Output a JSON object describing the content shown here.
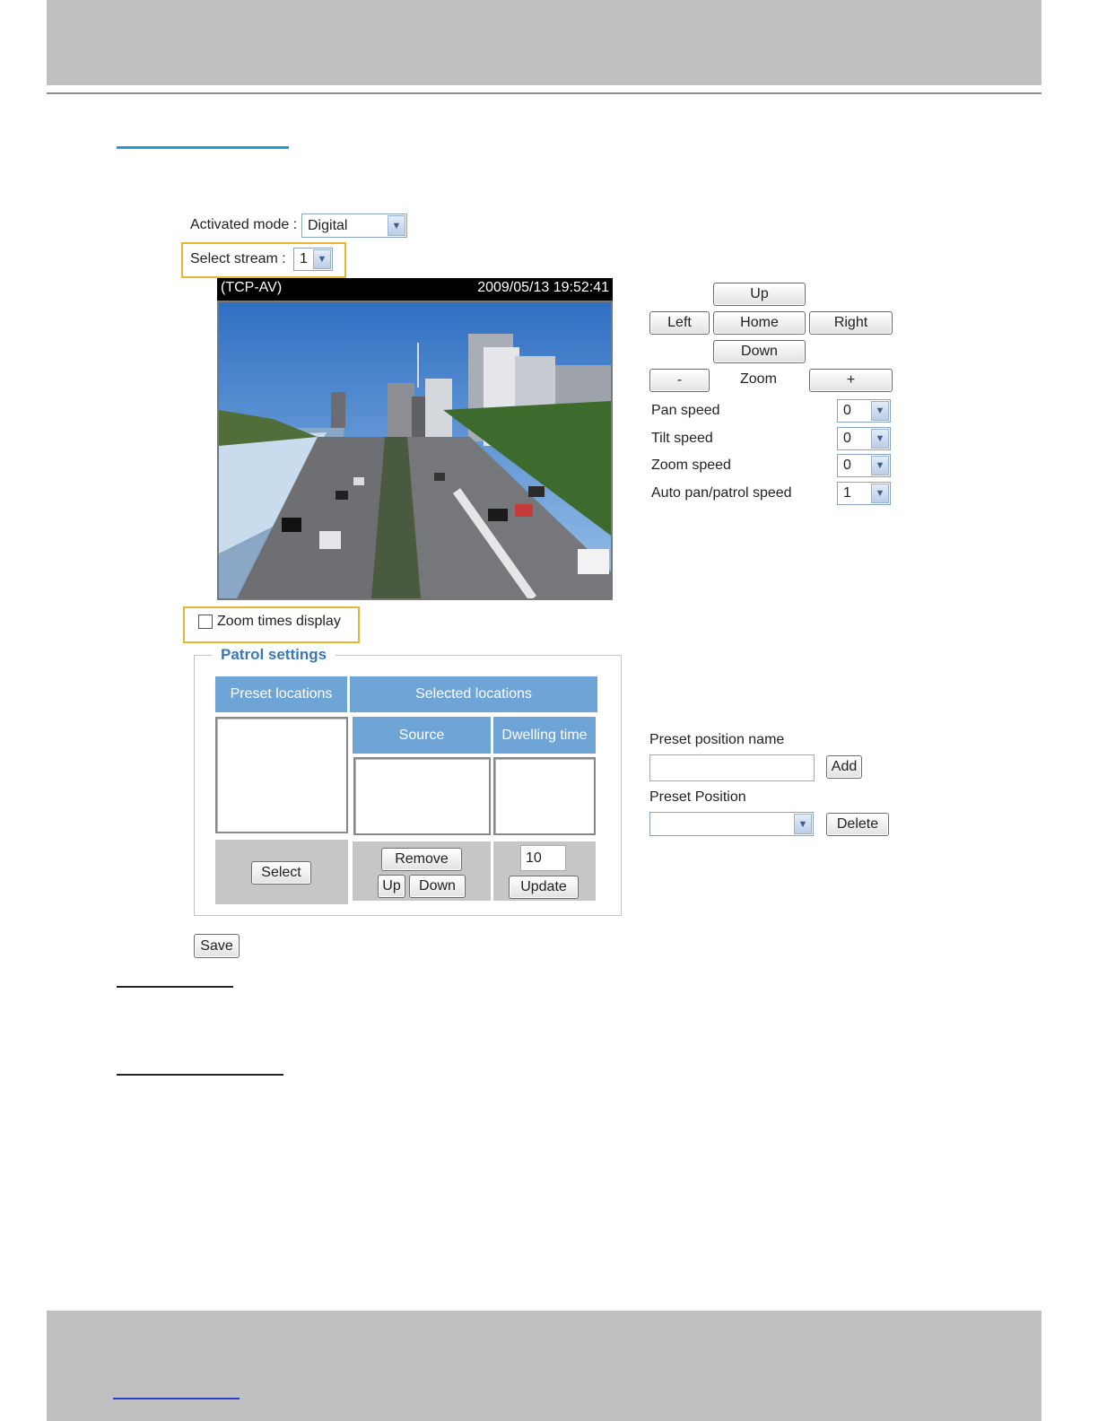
{
  "controls": {
    "activated_mode_label": "Activated mode :",
    "activated_mode_value": "Digital",
    "select_stream_label": "Select stream :",
    "select_stream_value": "1"
  },
  "video": {
    "protocol": "(TCP-AV)",
    "timestamp": "2009/05/13 19:52:41"
  },
  "ptz": {
    "up": "Up",
    "left": "Left",
    "home": "Home",
    "right": "Right",
    "down": "Down",
    "zoom_out": "-",
    "zoom_label": "Zoom",
    "zoom_in": "+",
    "speeds": [
      {
        "label": "Pan speed",
        "value": "0"
      },
      {
        "label": "Tilt speed",
        "value": "0"
      },
      {
        "label": "Zoom speed",
        "value": "0"
      },
      {
        "label": "Auto pan/patrol speed",
        "value": "1"
      }
    ]
  },
  "zoom_times_display": "Zoom times display",
  "patrol": {
    "legend": "Patrol settings",
    "preset_locations": "Preset locations",
    "selected_locations": "Selected locations",
    "source": "Source",
    "dwelling_time": "Dwelling time",
    "select_button": "Select",
    "remove_button": "Remove",
    "up_button": "Up",
    "down_button": "Down",
    "dwell_value": "10",
    "update_button": "Update"
  },
  "preset": {
    "name_label": "Preset position name",
    "add_button": "Add",
    "position_label": "Preset Position",
    "delete_button": "Delete"
  },
  "save_button": "Save",
  "colors": {
    "accent_blue": "#1f9ad6",
    "header_blue": "#6fa4d6",
    "highlight": "#e8b532",
    "band_grey": "#c0c0c0"
  }
}
